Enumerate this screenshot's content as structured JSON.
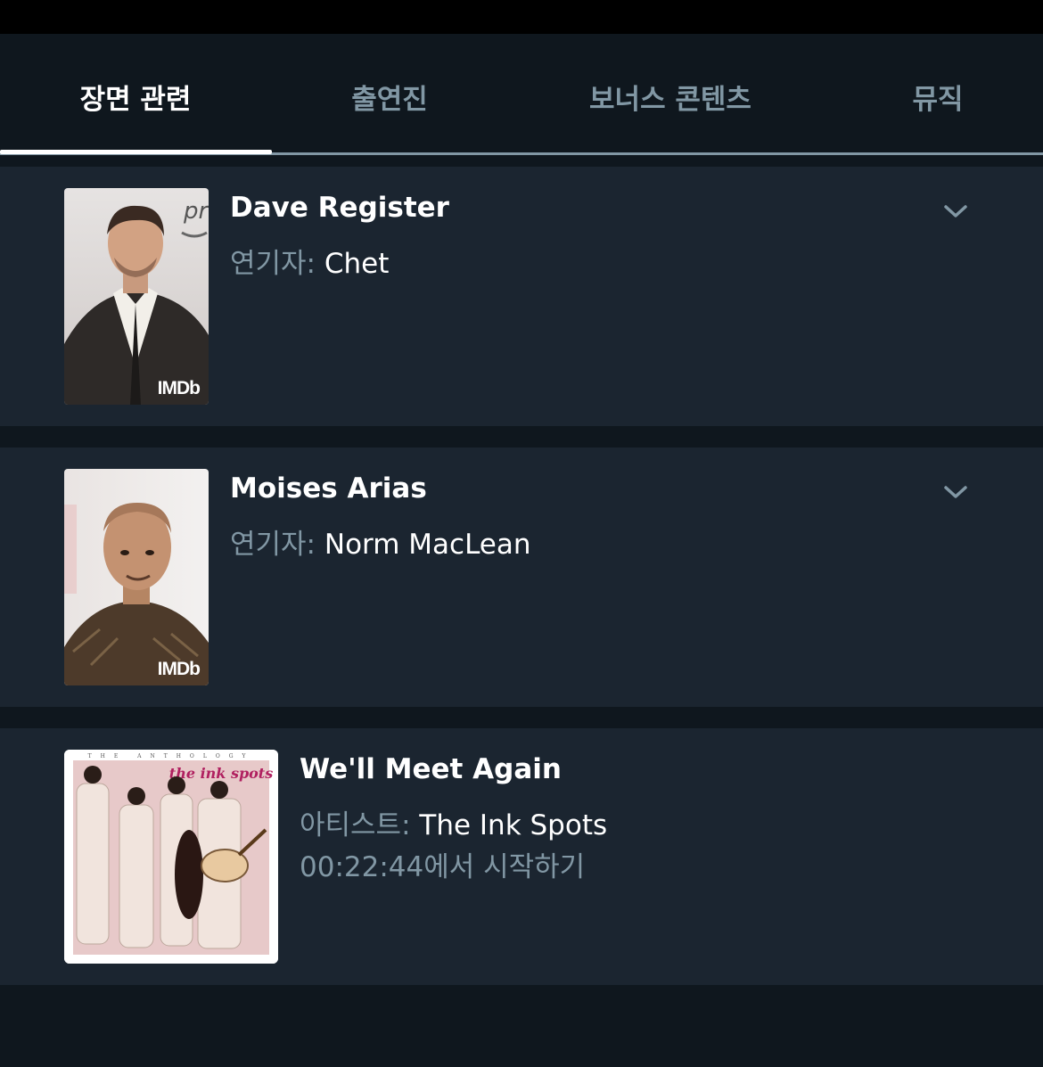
{
  "tabs": [
    {
      "label": "장면 관련",
      "active": true
    },
    {
      "label": "출연진",
      "active": false
    },
    {
      "label": "보너스 콘텐츠",
      "active": false
    },
    {
      "label": "뮤직",
      "active": false
    }
  ],
  "cast": [
    {
      "name": "Dave Register",
      "role_label": "연기자:",
      "role": "Chet",
      "badge": "IMDb",
      "icon": "chevron-down-icon"
    },
    {
      "name": "Moises Arias",
      "role_label": "연기자:",
      "role": "Norm MacLean",
      "badge": "IMDb",
      "icon": "chevron-down-icon"
    }
  ],
  "music": {
    "title": "We'll Meet Again",
    "artist_label": "아티스트:",
    "artist": "The Ink Spots",
    "resume": "00:22:44에서 시작하기",
    "album_top_text": "THE ANTHOLOGY",
    "album_logo_text": "the ink spots"
  },
  "colors": {
    "background": "#0f171e",
    "card": "#1b2530",
    "muted_text": "#8197a4",
    "primary_text": "#ffffff"
  }
}
